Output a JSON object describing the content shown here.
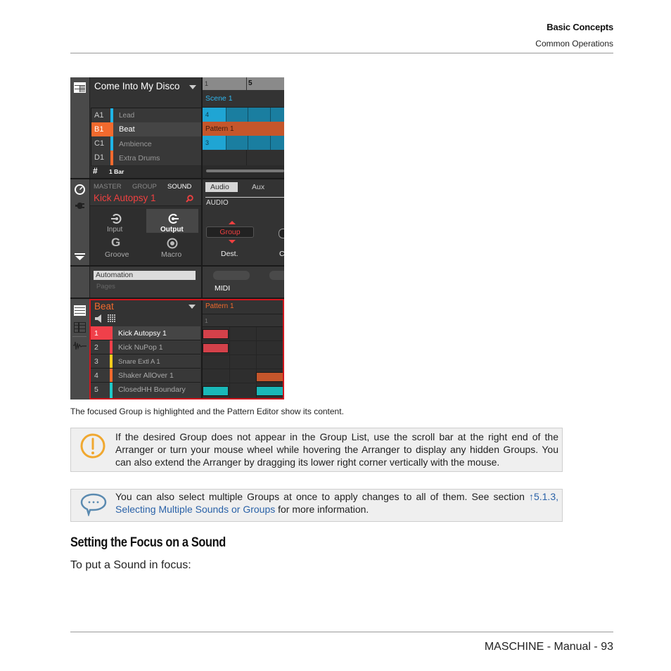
{
  "header": {
    "chapter": "Basic Concepts",
    "section": "Common Operations"
  },
  "screenshot": {
    "arranger": {
      "project_title": "Come Into My Disco",
      "groups": [
        {
          "slot": "A1",
          "name": "Lead",
          "color": "#1fb5e8"
        },
        {
          "slot": "B1",
          "name": "Beat",
          "color": "#f26a2e",
          "selected": true
        },
        {
          "slot": "C1",
          "name": "Ambience",
          "color": "#1fb5e8"
        },
        {
          "slot": "D1",
          "name": "Extra Drums",
          "color": "#f26a2e"
        }
      ],
      "grid_label": "1 Bar",
      "timeline": [
        "1",
        "5"
      ],
      "scene_label": "Scene 1",
      "clips": [
        {
          "label": "4",
          "color": "#1b9bc4"
        },
        {
          "label": "Pattern 1",
          "color": "#c5562b"
        },
        {
          "label": "3",
          "color": "#1b9bc4"
        }
      ]
    },
    "control": {
      "tabs": [
        "MASTER",
        "GROUP",
        "SOUND"
      ],
      "active_tab": "SOUND",
      "sound_name": "Kick Autopsy 1",
      "pages": [
        {
          "label": "Input",
          "icon": "input-icon"
        },
        {
          "label": "Output",
          "icon": "output-icon",
          "active": true
        },
        {
          "label": "Groove",
          "icon": "groove-icon"
        },
        {
          "label": "Macro",
          "icon": "macro-icon"
        }
      ],
      "sub_tabs": [
        "Audio",
        "Aux"
      ],
      "active_sub_tab": "Audio",
      "section_label": "AUDIO",
      "dest_value": "Group",
      "dest_label": "Dest.",
      "cut_label": "C",
      "automation_label": "Automation",
      "pages_label": "Pages",
      "midi_label": "MIDI"
    },
    "pattern_editor": {
      "group_name": "Beat",
      "pattern_name": "Pattern 1",
      "ruler": "1",
      "sounds": [
        {
          "num": "1",
          "name": "Kick Autopsy 1",
          "color": "#f0404a",
          "selected": true
        },
        {
          "num": "2",
          "name": "Kick NuPop 1",
          "color": "#f0404a"
        },
        {
          "num": "3",
          "name": "Snare Extl A 1",
          "color": "#f5cc1c"
        },
        {
          "num": "4",
          "name": "Shaker AllOver 1",
          "color": "#f26a2e"
        },
        {
          "num": "5",
          "name": "ClosedHH Boundary",
          "color": "#1fc8c8"
        }
      ]
    }
  },
  "caption": "The focused Group is highlighted and the Pattern Editor show its content.",
  "warning_note": "If the desired Group does not appear in the Group List, use the scroll bar at the right end of the Arranger or turn your mouse wheel while hovering the Arranger to display any hidden Groups. You can also extend the Arranger by dragging its lower right corner vertically with the mouse.",
  "tip_note": {
    "text_before": "You can also select multiple Groups at once to apply changes to all of them. See section ",
    "link_ref": "↑5.1.3,",
    "link_title": "Selecting Multiple Sounds or Groups",
    "text_after": " for more information."
  },
  "section_heading": "Setting the Focus on a Sound",
  "body_text": "To put a Sound in focus:",
  "footer": {
    "text": "MASCHINE - Manual - 93"
  }
}
